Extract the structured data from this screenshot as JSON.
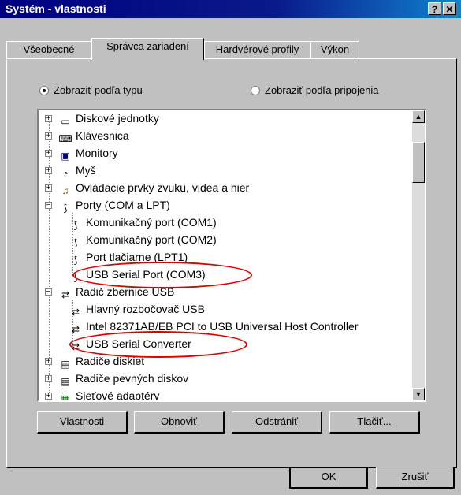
{
  "window": {
    "title": "Systém - vlastnosti",
    "help_btn": "?",
    "close_btn": "✕"
  },
  "tabs": [
    {
      "label": "Všeobecné",
      "active": false
    },
    {
      "label": "Správca zariadení",
      "active": true
    },
    {
      "label": "Hardvérové profily",
      "active": false
    },
    {
      "label": "Výkon",
      "active": false
    }
  ],
  "view_options": {
    "by_type": {
      "label": "Zobraziť podľa typu",
      "checked": true
    },
    "by_connection": {
      "label": "Zobraziť podľa pripojenia",
      "checked": false
    }
  },
  "tree": {
    "disk_drives": "Diskové jednotky",
    "keyboard": "Klávesnica",
    "monitors": "Monitory",
    "mouse": "Myš",
    "sound": "Ovládacie prvky zvuku, videa a hier",
    "ports": "Porty (COM a LPT)",
    "com1": "Komunikačný port (COM1)",
    "com2": "Komunikačný port (COM2)",
    "lpt1": "Port tlačiarne (LPT1)",
    "com3": "USB Serial Port (COM3)",
    "usb_controller": "Radič zbernice USB",
    "usb_hub": "Hlavný rozbočovač USB",
    "intel_usb": "Intel 82371AB/EB PCI to USB Universal Host Controller",
    "usb_converter": "USB Serial Converter",
    "floppy": "Radiče diskiet",
    "hdd": "Radiče pevných diskov",
    "network": "Sieťové adaptéry"
  },
  "buttons": {
    "properties": "Vlastnosti",
    "refresh": "Obnoviť",
    "remove": "Odstrániť",
    "print": "Tlačiť..."
  },
  "dialog_buttons": {
    "ok": "OK",
    "cancel": "Zrušiť"
  },
  "colors": {
    "title_bar": "#000080",
    "highlight_oval": "#e00000",
    "face": "#c0c0c0"
  }
}
